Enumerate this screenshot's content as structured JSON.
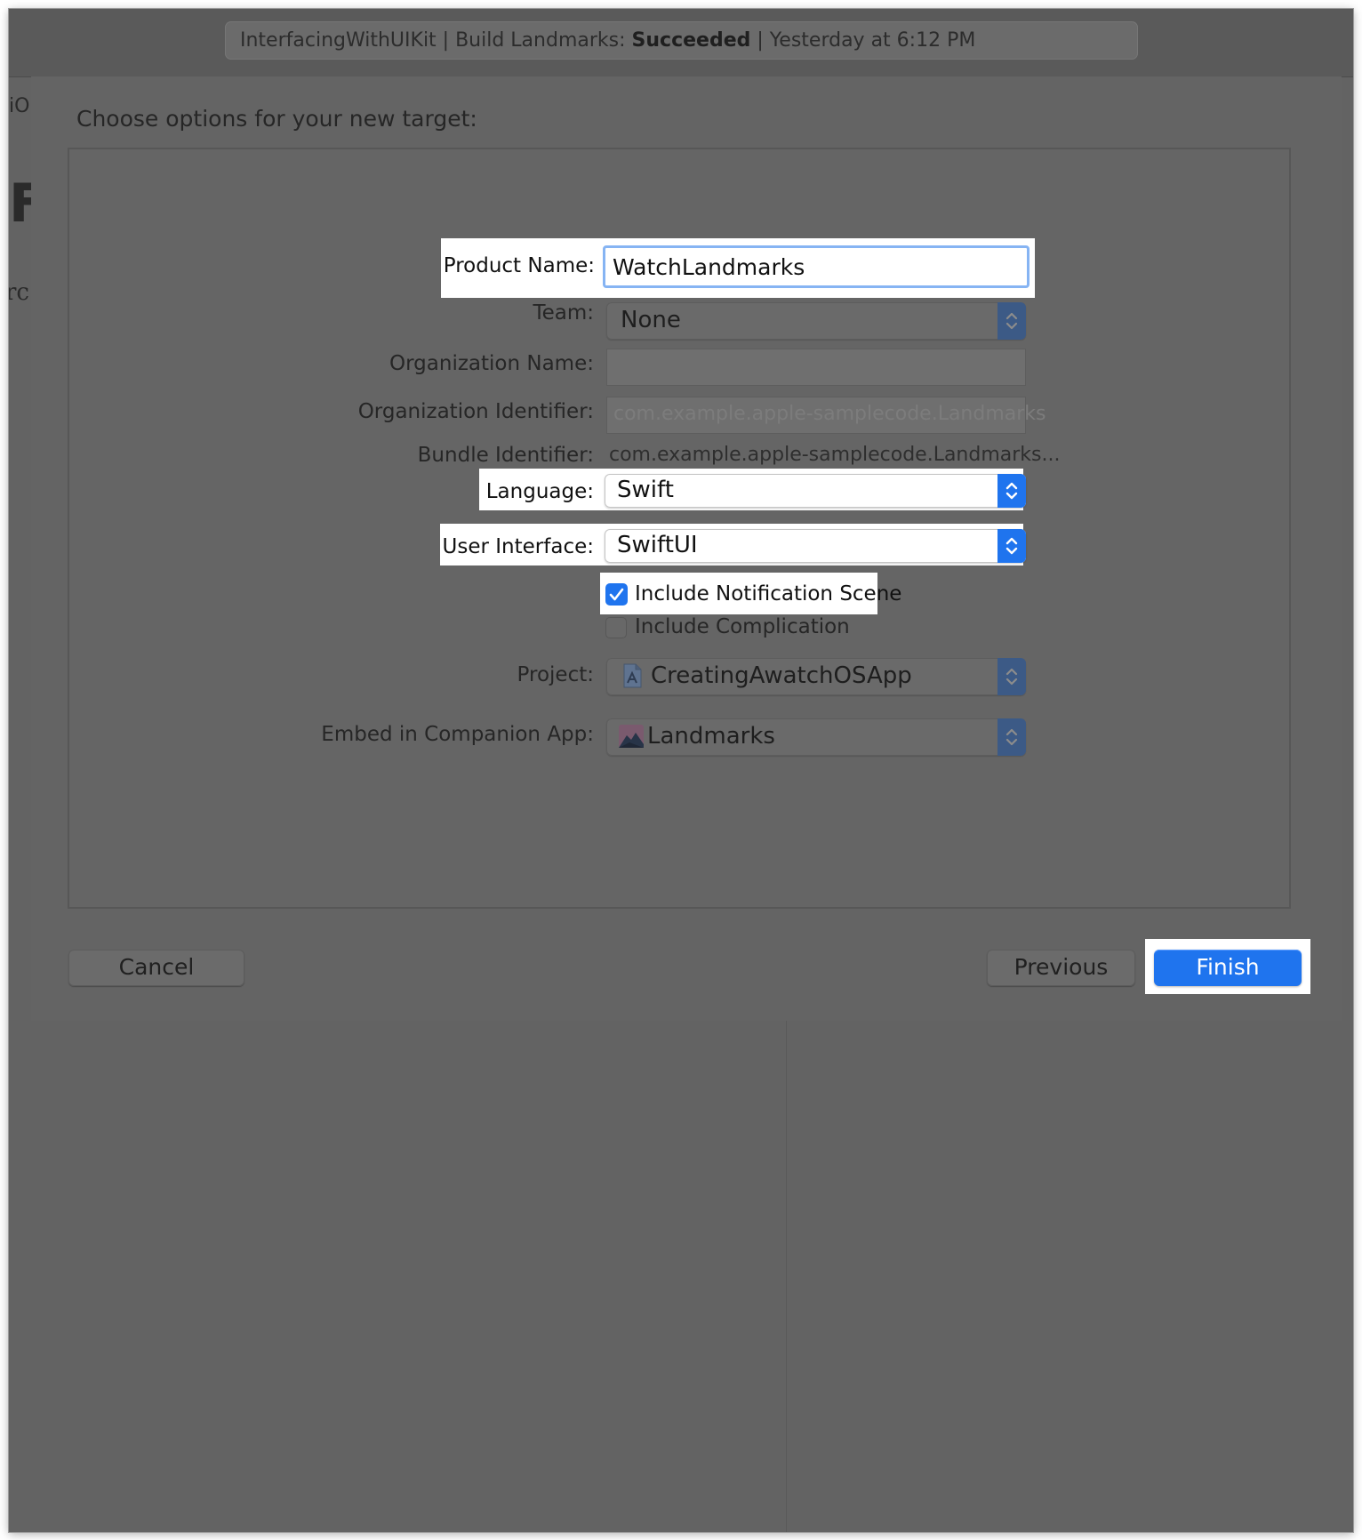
{
  "activity": {
    "prefix": "InterfacingWithUIKit | Build Landmarks: ",
    "status": "Succeeded",
    "suffix": " | Yesterday at 6:12 PM"
  },
  "background": {
    "fragment_top": "iO",
    "fragment_big": "F",
    "fragment_bottom": "rc"
  },
  "sheet": {
    "title": "Choose options for your new target:"
  },
  "form": {
    "product_name": {
      "label": "Product Name:",
      "value": "WatchLandmarks"
    },
    "team": {
      "label": "Team:",
      "value": "None"
    },
    "organization_name": {
      "label": "Organization Name:",
      "value": ""
    },
    "organization_identifier": {
      "label": "Organization Identifier:",
      "placeholder": "com.example.apple-samplecode.Landmarks"
    },
    "bundle_identifier": {
      "label": "Bundle Identifier:",
      "value": "com.example.apple-samplecode.Landmarks..."
    },
    "language": {
      "label": "Language:",
      "value": "Swift"
    },
    "user_interface": {
      "label": "User Interface:",
      "value": "SwiftUI"
    },
    "include_notification_scene": {
      "label": "Include Notification Scene",
      "checked": true
    },
    "include_complication": {
      "label": "Include Complication",
      "checked": false
    },
    "project": {
      "label": "Project:",
      "value": "CreatingAwatchOSApp",
      "icon": "project-file-icon"
    },
    "embed_in_companion_app": {
      "label": "Embed in Companion App:",
      "value": "Landmarks",
      "icon": "landmarks-app-icon"
    }
  },
  "buttons": {
    "cancel": "Cancel",
    "previous": "Previous",
    "finish": "Finish"
  },
  "colors": {
    "accent": "#1f74ee",
    "overlay_gray": "#646464",
    "highlight": "#ffffff"
  }
}
